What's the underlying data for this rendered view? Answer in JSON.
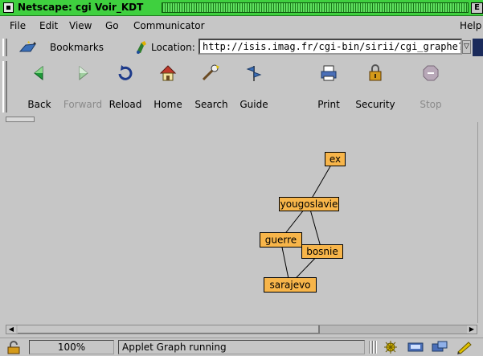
{
  "window": {
    "title": "Netscape: cgi Voir_KDT",
    "control_glyph": "E"
  },
  "menu": {
    "items": [
      "File",
      "Edit",
      "View",
      "Go",
      "Communicator"
    ],
    "help": "Help"
  },
  "location_bar": {
    "bookmarks_label": "Bookmarks",
    "location_label": "Location:",
    "url": "http://isis.imag.fr/cgi-bin/sirii/cgi_graphe?",
    "dropdown_glyph": "▽"
  },
  "toolbar": {
    "buttons": [
      {
        "label": "Back",
        "icon": "back-arrow-icon",
        "enabled": true
      },
      {
        "label": "Forward",
        "icon": "forward-arrow-icon",
        "enabled": false
      },
      {
        "label": "Reload",
        "icon": "reload-icon",
        "enabled": true
      },
      {
        "label": "Home",
        "icon": "home-icon",
        "enabled": true
      },
      {
        "label": "Search",
        "icon": "search-icon",
        "enabled": true
      },
      {
        "label": "Guide",
        "icon": "guide-icon",
        "enabled": true
      },
      {
        "label": "Print",
        "icon": "print-icon",
        "enabled": true
      },
      {
        "label": "Security",
        "icon": "security-lock-icon",
        "enabled": true
      },
      {
        "label": "Stop",
        "icon": "stop-icon",
        "enabled": false
      }
    ]
  },
  "graph": {
    "node_color": "#f7b54a",
    "nodes": [
      {
        "id": "ex",
        "label": "ex"
      },
      {
        "id": "yougoslavie",
        "label": "yougoslavie"
      },
      {
        "id": "guerre",
        "label": "guerre"
      },
      {
        "id": "bosnie",
        "label": "bosnie"
      },
      {
        "id": "sarajevo",
        "label": "sarajevo"
      }
    ],
    "edges": [
      [
        "ex",
        "yougoslavie"
      ],
      [
        "yougoslavie",
        "guerre"
      ],
      [
        "yougoslavie",
        "bosnie"
      ],
      [
        "guerre",
        "bosnie"
      ],
      [
        "guerre",
        "sarajevo"
      ],
      [
        "bosnie",
        "sarajevo"
      ]
    ]
  },
  "status_bar": {
    "zoom": "100%",
    "message": "Applet Graph running"
  },
  "colors": {
    "title_bar": "#3fd03f",
    "chrome": "#c6c6c6",
    "node_fill": "#f7b54a"
  }
}
